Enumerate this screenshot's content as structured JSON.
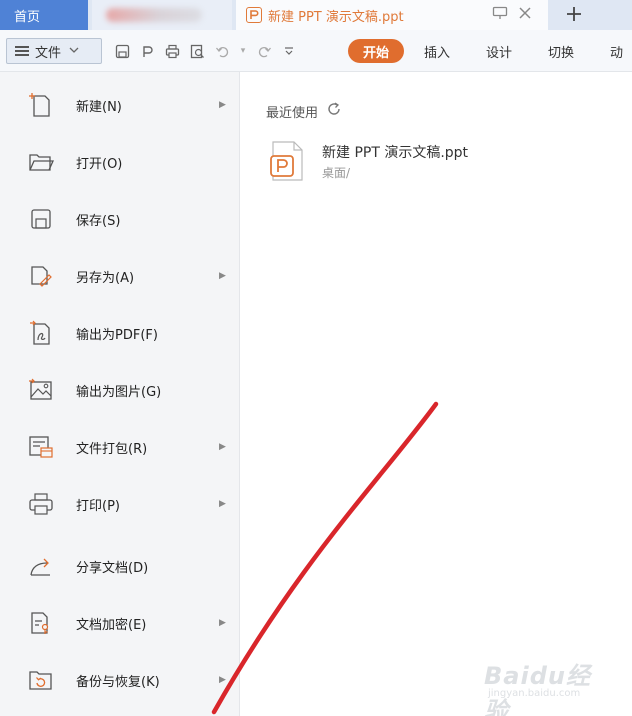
{
  "tabs": {
    "home_label": "首页",
    "doc_title": "新建 PPT 演示文稿.ppt"
  },
  "toolbar": {
    "file_label": "文件",
    "start_label": "开始",
    "menu_tabs": [
      "插入",
      "设计",
      "切换",
      "动"
    ]
  },
  "file_menu": {
    "items": [
      {
        "label": "新建(N)",
        "icon": "new-file-icon",
        "submenu": true
      },
      {
        "label": "打开(O)",
        "icon": "folder-open-icon",
        "submenu": false
      },
      {
        "label": "保存(S)",
        "icon": "save-icon",
        "submenu": false
      },
      {
        "label": "另存为(A)",
        "icon": "save-as-icon",
        "submenu": true
      },
      {
        "label": "输出为PDF(F)",
        "icon": "pdf-export-icon",
        "submenu": false
      },
      {
        "label": "输出为图片(G)",
        "icon": "image-export-icon",
        "submenu": false
      },
      {
        "label": "文件打包(R)",
        "icon": "package-icon",
        "submenu": true
      },
      {
        "label": "打印(P)",
        "icon": "print-icon",
        "submenu": true
      },
      {
        "label": "分享文档(D)",
        "icon": "share-icon",
        "submenu": false
      },
      {
        "label": "文档加密(E)",
        "icon": "encrypt-icon",
        "submenu": true
      },
      {
        "label": "备份与恢复(K)",
        "icon": "backup-icon",
        "submenu": true
      }
    ]
  },
  "recent": {
    "title": "最近使用",
    "files": [
      {
        "name": "新建 PPT 演示文稿.ppt",
        "path": "桌面/"
      }
    ]
  },
  "watermark": {
    "text": "Baidu经验",
    "sub": "jingyan.baidu.com"
  },
  "colors": {
    "accent_orange": "#e06d2e",
    "home_tab_blue": "#4f82d6",
    "arrow_red": "#d9262b"
  }
}
